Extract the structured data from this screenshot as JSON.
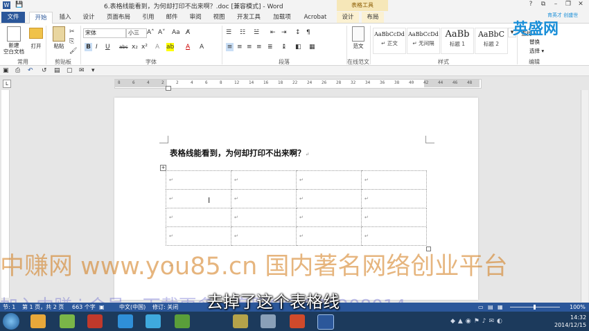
{
  "window": {
    "title": "6.表格线能看到，为何却打印不出来啊？.doc [兼容模式] - Word",
    "context_group": "表格工具",
    "buttons": [
      "?",
      "⧉",
      "–",
      "❐",
      "✕"
    ]
  },
  "tabs": [
    "文件",
    "开始",
    "插入",
    "设计",
    "页面布局",
    "引用",
    "邮件",
    "审阅",
    "视图",
    "开发工具",
    "加载项",
    "Acrobat",
    "设计",
    "布局"
  ],
  "ribbon": {
    "new_blank": "新建\n空白文档",
    "open": "打开",
    "paste": "粘贴",
    "font_name": "宋体",
    "font_size": "小三",
    "format_buttons": [
      "B",
      "I",
      "U",
      "abc",
      "x₂",
      "x²"
    ],
    "template": "范文",
    "styles": [
      {
        "sample": "AaBbCcDd",
        "name": "↵ 正文"
      },
      {
        "sample": "AaBbCcDd",
        "name": "↵ 无间隔"
      },
      {
        "sample": "AaBb",
        "name": "标题 1"
      },
      {
        "sample": "AaBbC",
        "name": "标题 2"
      }
    ],
    "edit_items": [
      "查找 ▾",
      "替换",
      "选择 ▾"
    ],
    "groups": [
      "常用",
      "剪贴板",
      "字体",
      "段落",
      "在线范文",
      "样式",
      "编辑"
    ]
  },
  "ruler": {
    "ticks": [
      "8",
      "6",
      "4",
      "2",
      "2",
      "4",
      "6",
      "8",
      "12",
      "14",
      "16",
      "18",
      "22",
      "24",
      "26",
      "28",
      "32",
      "34",
      "36",
      "38",
      "40",
      "42",
      "44",
      "46",
      "48"
    ]
  },
  "document": {
    "heading": "表格线能看到，为何却打印不出来啊？",
    "table": {
      "rows": 4,
      "cols": 4,
      "cell_mark": "↵"
    },
    "para_mark": "↵"
  },
  "overlays": {
    "watermark_line1": "中赚网 www.you85.cn 国内著名网络创业平台",
    "watermark_line2": "加入中赚 i 会员，下载更多，客服QQ 870208014",
    "subtitle": "去掉了这个表格线",
    "corner_logo": "英盛网",
    "corner_tag": "育英才 创盛世"
  },
  "statusbar": {
    "section": "节: 1",
    "page": "第 1 页，共 2 页",
    "words": "663 个字",
    "lang": "中文(中国)",
    "revise": "修订: 关闭",
    "zoom": "100%"
  },
  "taskbar": {
    "time": "14:32",
    "date": "2014/12/15"
  },
  "colors": {
    "accent": "#2b579a",
    "context_tab": "#f6e7b8",
    "taskbar": "#1c3a5c"
  }
}
